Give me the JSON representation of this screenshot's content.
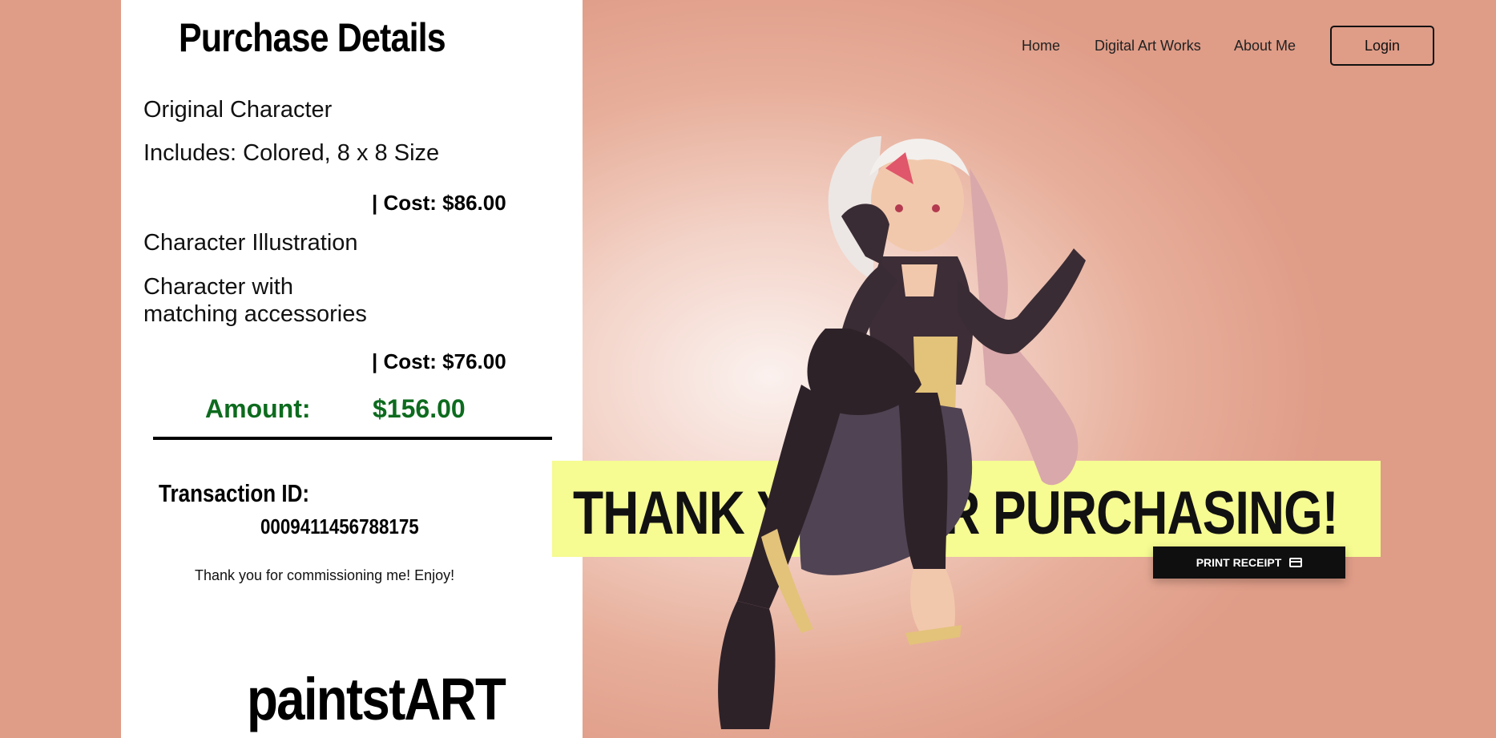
{
  "receipt": {
    "title": "Purchase Details",
    "items": [
      {
        "name": "Original Character",
        "description": "Includes: Colored, 8 x 8 Size",
        "cost": "| Cost: $86.00"
      },
      {
        "name": "Character Illustration",
        "description_line1": "Character with",
        "description_line2": "matching accessories",
        "cost": "| Cost: $76.00"
      }
    ],
    "amount_label": "Amount:",
    "amount_value": "$156.00",
    "transaction_label": "Transaction ID:",
    "transaction_id": "0009411456788175",
    "thanks_note": "Thank you for commissioning me! Enjoy!",
    "brand": "paintstART"
  },
  "nav": {
    "links": [
      "Home",
      "Digital Art Works",
      "About Me"
    ],
    "login": "Login"
  },
  "banner": {
    "text": "THANK YOU FOR PURCHASING!"
  },
  "print_button": {
    "label": "PRINT RECEIPT",
    "icon": "credit-card-icon"
  },
  "colors": {
    "background": "#e7ae9a",
    "banner": "#f6fb92",
    "amount": "#0d6b1e",
    "button": "#0f0f0f"
  }
}
